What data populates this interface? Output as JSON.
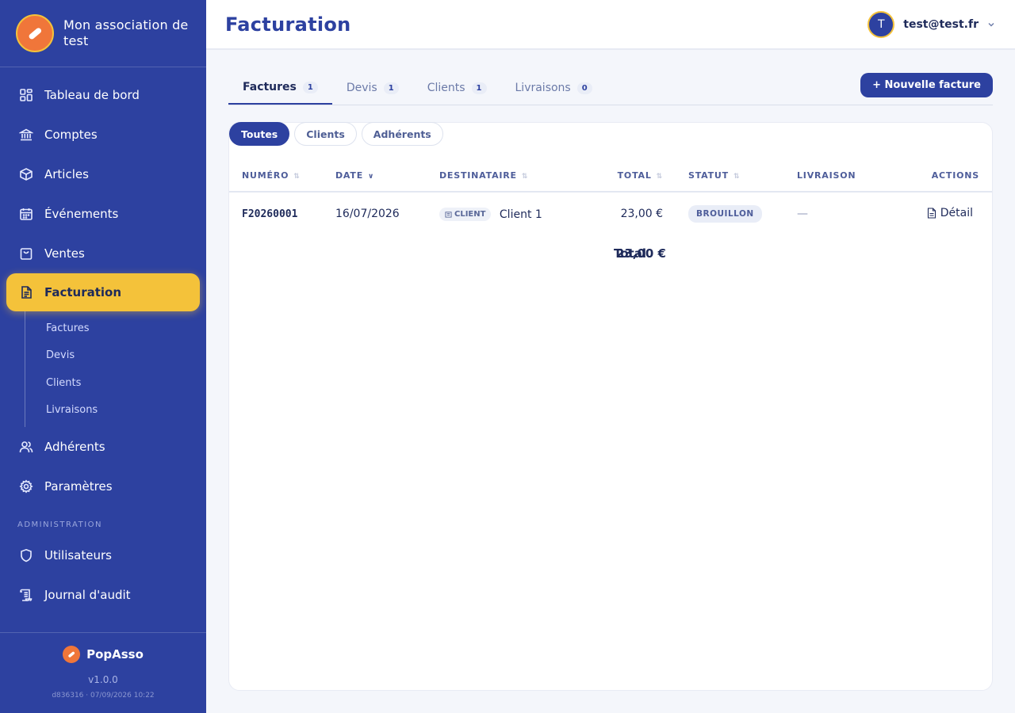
{
  "sidebar": {
    "org_name": "Mon association de test",
    "nav": [
      {
        "label": "Tableau de bord",
        "icon": "dashboard-icon"
      },
      {
        "label": "Comptes",
        "icon": "bank-icon"
      },
      {
        "label": "Articles",
        "icon": "box-icon"
      },
      {
        "label": "Événements",
        "icon": "calendar-icon"
      },
      {
        "label": "Ventes",
        "icon": "shopping-bag-icon"
      },
      {
        "label": "Facturation",
        "icon": "document-icon",
        "active": true
      }
    ],
    "subnav": [
      "Factures",
      "Devis",
      "Clients",
      "Livraisons"
    ],
    "nav2": [
      {
        "label": "Adhérents",
        "icon": "users-icon"
      },
      {
        "label": "Paramètres",
        "icon": "gear-icon"
      }
    ],
    "section_admin": "ADMINISTRATION",
    "admin": [
      {
        "label": "Utilisateurs",
        "icon": "shield-icon"
      },
      {
        "label": "Journal d'audit",
        "icon": "scroll-icon"
      }
    ],
    "footer": {
      "brand": "PopAsso",
      "version": "v1.0.0",
      "build": "d836316 · 07/09/2026 10:22"
    }
  },
  "header": {
    "title": "Facturation",
    "user_initial": "T",
    "user_email": "test@test.fr"
  },
  "tabs": [
    {
      "label": "Factures",
      "count": "1",
      "active": true
    },
    {
      "label": "Devis",
      "count": "1"
    },
    {
      "label": "Clients",
      "count": "1"
    },
    {
      "label": "Livraisons",
      "count": "0"
    }
  ],
  "new_button": "+ Nouvelle facture",
  "filters": [
    {
      "label": "Toutes",
      "active": true
    },
    {
      "label": "Clients"
    },
    {
      "label": "Adhérents"
    }
  ],
  "table": {
    "columns": {
      "numero": "NUMÉRO",
      "date": "DATE",
      "destinataire": "DESTINATAIRE",
      "total": "TOTAL",
      "statut": "STATUT",
      "livraison": "LIVRAISON",
      "actions": "ACTIONS"
    },
    "rows": [
      {
        "numero": "F20260001",
        "date": "16/07/2026",
        "badge": "CLIENT",
        "destinataire": "Client 1",
        "total": "23,00 €",
        "statut": "BROUILLON",
        "livraison": "—",
        "action": "Détail"
      }
    ],
    "footer_label": "Total",
    "footer_total": "23,00 €"
  },
  "colors": {
    "sidebar": "#2d41a0",
    "accent": "#f4c23a",
    "logo": "#f0763a"
  }
}
